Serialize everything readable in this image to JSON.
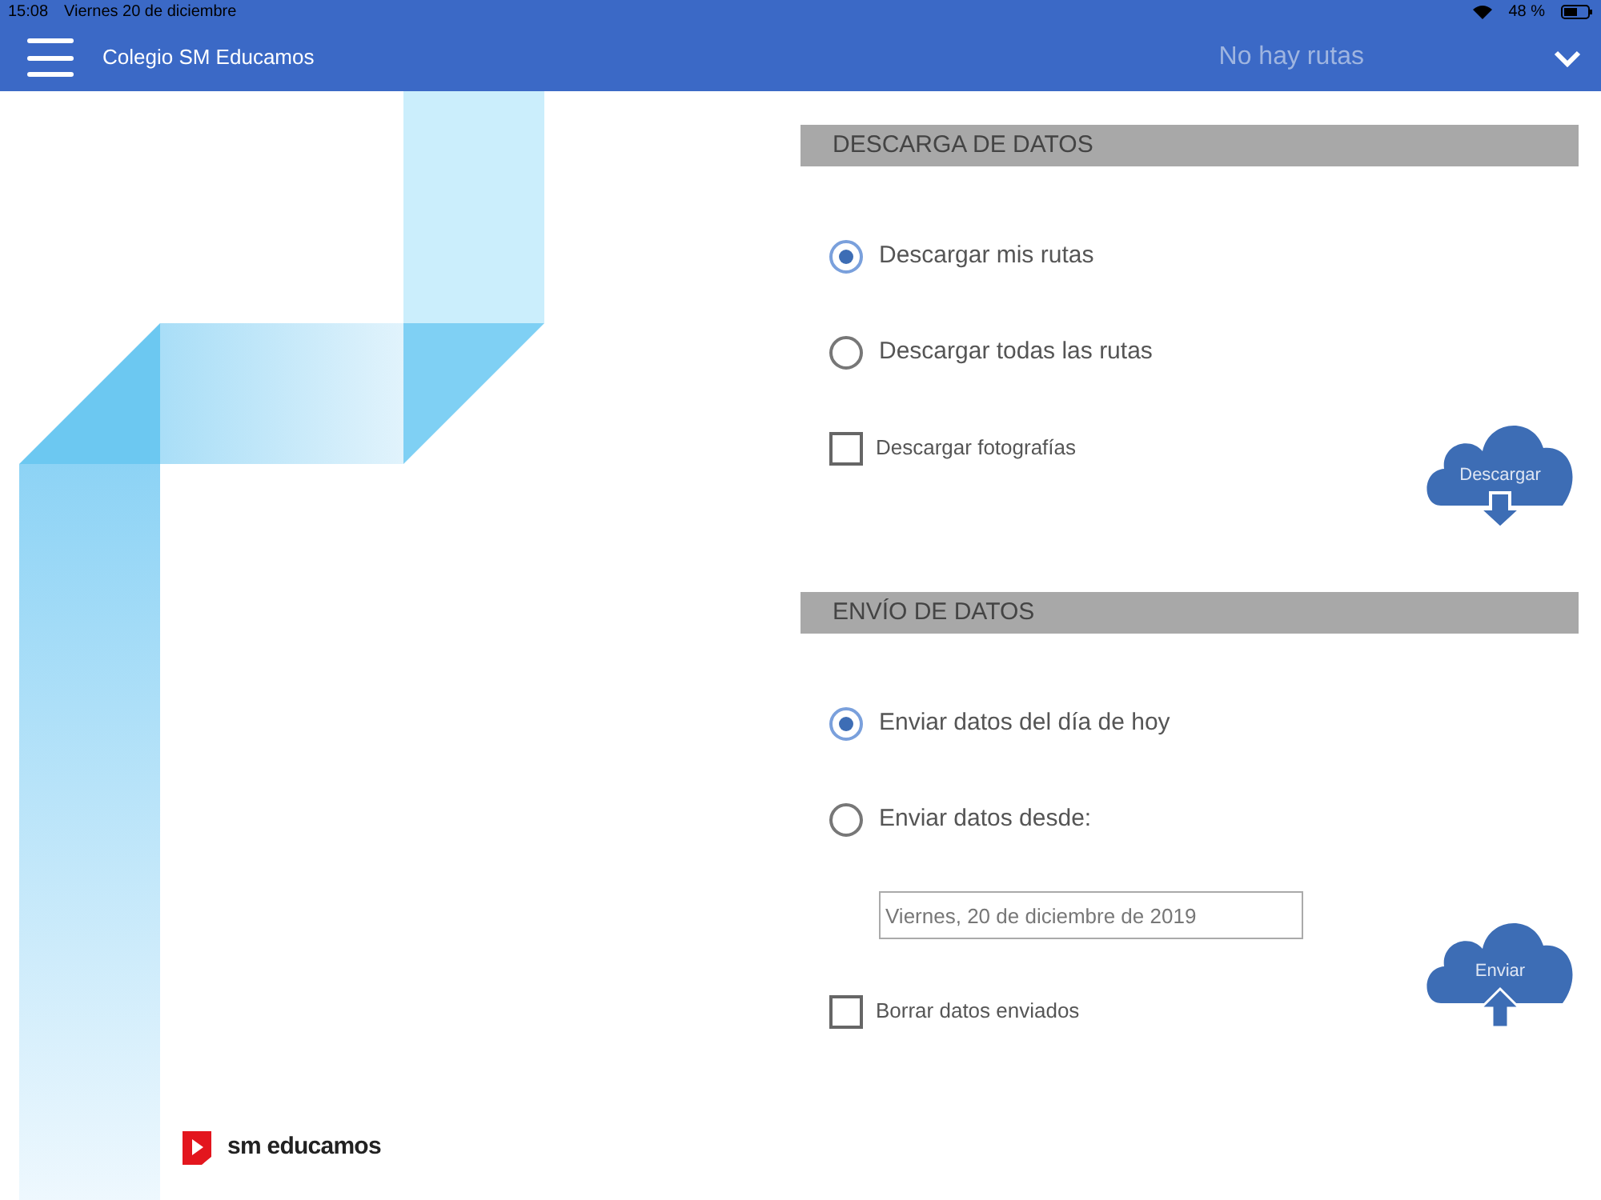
{
  "status_bar": {
    "time": "15:08",
    "date": "Viernes 20 de diciembre",
    "battery": "48 %"
  },
  "header": {
    "title": "Colegio SM Educamos",
    "route": "No hay rutas"
  },
  "logo": {
    "text": "sm educamos"
  },
  "sections": [
    {
      "title": "DESCARGA DE DATOS",
      "button": {
        "kind": "download",
        "label": "Descargar"
      },
      "items": [
        {
          "kind": "radio",
          "label": "Descargar mis rutas",
          "selected": true
        },
        {
          "kind": "radio",
          "label": "Descargar todas las rutas",
          "selected": false
        },
        {
          "kind": "checkbox",
          "label": "Descargar fotografías",
          "checked": false
        }
      ]
    },
    {
      "title": "ENVÍO DE DATOS",
      "button": {
        "kind": "upload",
        "label": "Enviar"
      },
      "items": [
        {
          "kind": "radio",
          "label": "Enviar datos del día de hoy",
          "selected": true
        },
        {
          "kind": "radio",
          "label": "Enviar datos desde:",
          "selected": false
        },
        {
          "kind": "date_field",
          "value": "Viernes, 20 de diciembre de 2019"
        },
        {
          "kind": "checkbox",
          "label": "Borrar datos enviados",
          "checked": false
        }
      ]
    }
  ]
}
